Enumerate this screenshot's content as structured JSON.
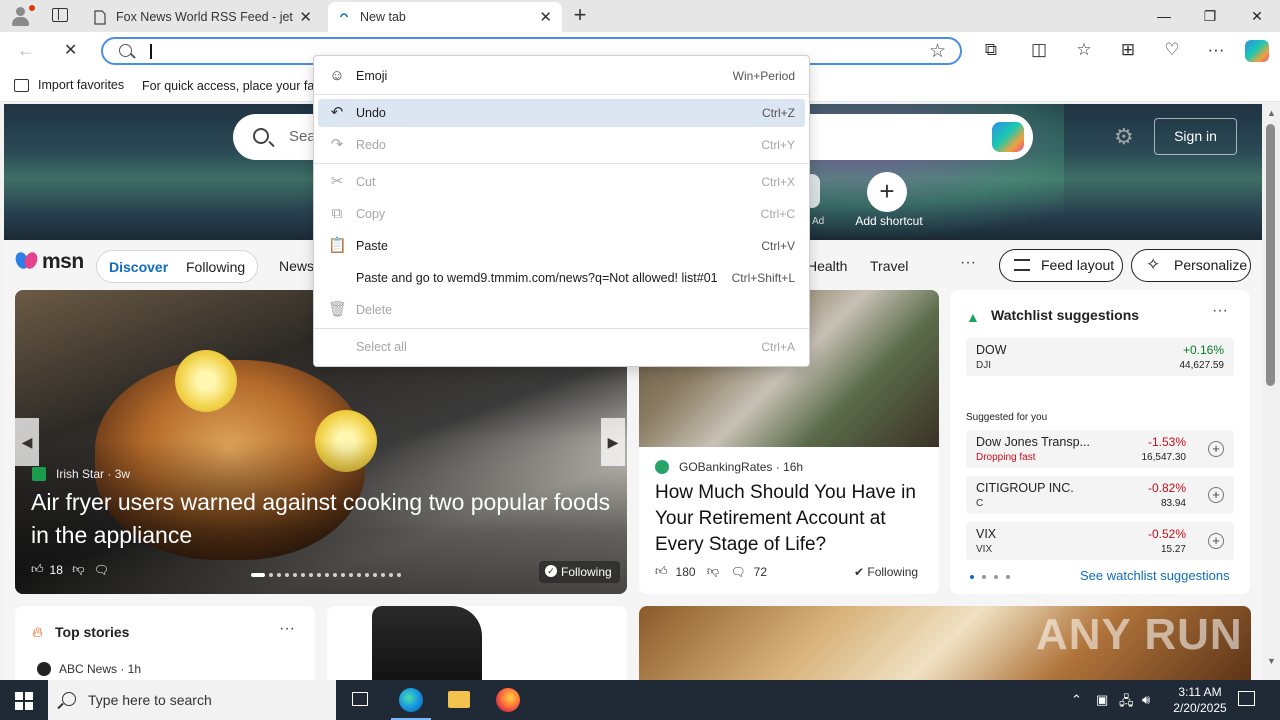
{
  "browser": {
    "tabs": [
      {
        "title": "Fox News World RSS Feed - jet-ai",
        "close": "✕"
      },
      {
        "title": "New tab",
        "close": "✕"
      }
    ],
    "new_tab": "+",
    "window_controls": {
      "minimize": "—",
      "maximize": "❐",
      "close": "✕"
    },
    "address_value": "",
    "favorites_bar": {
      "import_label": "Import favorites",
      "hint": "For quick access, place your favorites here"
    }
  },
  "context_menu": {
    "items": [
      {
        "icon": "emoji-icon",
        "glyph": "☺",
        "label": "Emoji",
        "shortcut": "Win+Period",
        "enabled": true
      },
      {
        "icon": "undo-icon",
        "glyph": "↶",
        "label": "Undo",
        "shortcut": "Ctrl+Z",
        "enabled": true,
        "highlighted": true
      },
      {
        "icon": "redo-icon",
        "glyph": "↷",
        "label": "Redo",
        "shortcut": "Ctrl+Y",
        "enabled": false
      },
      {
        "icon": "cut-icon",
        "glyph": "✂",
        "label": "Cut",
        "shortcut": "Ctrl+X",
        "enabled": false
      },
      {
        "icon": "copy-icon",
        "glyph": "⧉",
        "label": "Copy",
        "shortcut": "Ctrl+C",
        "enabled": false
      },
      {
        "icon": "paste-icon",
        "glyph": "📋",
        "label": "Paste",
        "shortcut": "Ctrl+V",
        "enabled": true
      },
      {
        "icon": "",
        "glyph": "",
        "label": "Paste and go to wemd9.tmmim.com/news?q=Not allowed! list#01",
        "shortcut": "Ctrl+Shift+L",
        "enabled": true
      },
      {
        "icon": "delete-icon",
        "glyph": "🗑",
        "label": "Delete",
        "shortcut": "",
        "enabled": false
      },
      {
        "icon": "",
        "glyph": "",
        "label": "Select all",
        "shortcut": "Ctrl+A",
        "enabled": false
      }
    ]
  },
  "newtab_page": {
    "search_placeholder": "Search",
    "sign_in": "Sign in",
    "add_shortcut": "Add shortcut",
    "ad_label": "Ad",
    "msn_logo": "msn",
    "feed_tabs": {
      "discover": "Discover",
      "following": "Following"
    },
    "nav_links": [
      "News",
      "Health",
      "Travel"
    ],
    "nav_more": "···",
    "feed_layout": "Feed layout",
    "personalize": "Personalize"
  },
  "hero_story": {
    "source": "Irish Star",
    "age": "3w",
    "headline": "Air fryer users warned against cooking two popular foods in the appliance",
    "likes": "18",
    "following": "Following"
  },
  "mid_story": {
    "source": "GOBankingRates",
    "age": "16h",
    "headline": "How Much Should You Have in Your Retirement Account at Every Stage of Life?",
    "likes": "180",
    "comments": "72",
    "following": "Following"
  },
  "watchlist": {
    "title": "Watchlist suggestions",
    "more": "···",
    "main": {
      "name": "DOW",
      "ticker": "DJI",
      "change": "+0.16%",
      "price": "44,627.59"
    },
    "suggested_label": "Suggested for you",
    "suggestions": [
      {
        "name": "Dow Jones Transp...",
        "sub": "Dropping fast",
        "change": "-1.53%",
        "price": "16,547.30"
      },
      {
        "name": "CITIGROUP INC.",
        "sub": "C",
        "change": "-0.82%",
        "price": "83.94"
      },
      {
        "name": "VIX",
        "sub": "VIX",
        "change": "-0.52%",
        "price": "15.27"
      }
    ],
    "see_all": "See watchlist suggestions"
  },
  "top_stories": {
    "title": "Top stories",
    "more": "···",
    "first_source": "ABC News · 1h"
  },
  "watermark": "ANY RUN",
  "taskbar": {
    "search_placeholder": "Type here to search",
    "time": "3:11 AM",
    "date": "2/20/2025"
  },
  "colors": {
    "accent": "#0f6cbd",
    "address_focus": "#4a90e2",
    "menu_highlight": "#dbe6f2",
    "negative": "#c50f1f",
    "positive": "#0a7d2b"
  }
}
